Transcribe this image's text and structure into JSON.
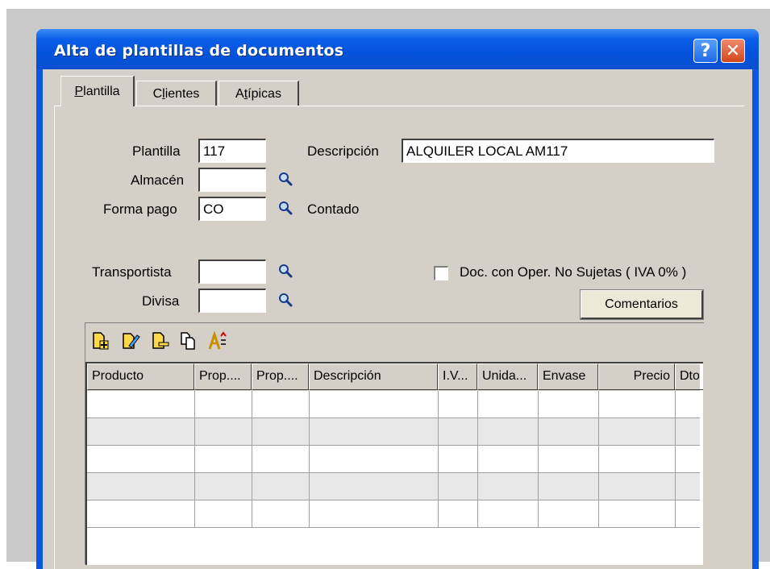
{
  "window": {
    "title": "Alta  de plantillas de documentos",
    "help_label": "?",
    "close_label": "✕"
  },
  "tabs": [
    {
      "label_ul": "P",
      "label_rest": "lantilla"
    },
    {
      "label_pre": "C",
      "label_ul": "l",
      "label_rest": "ientes"
    },
    {
      "label_pre": "A",
      "label_ul": "t",
      "label_rest": "ípicas"
    }
  ],
  "form": {
    "plantilla_label": "Plantilla",
    "plantilla_value": "117",
    "descripcion_label": "Descripción",
    "descripcion_value": "ALQUILER LOCAL AM117",
    "almacen_label": "Almacén",
    "almacen_value": "",
    "forma_pago_label": "Forma pago",
    "forma_pago_value": "CO",
    "forma_pago_desc": "Contado",
    "transportista_label": "Transportista",
    "transportista_value": "",
    "divisa_label": "Divisa",
    "divisa_value": "",
    "no_sujetas_label": "Doc. con Oper. No Sujetas ( IVA 0% )",
    "no_sujetas_checked": false,
    "comentarios_label": "Comentarios"
  },
  "toolbar_icons": [
    "add-line-icon",
    "edit-line-icon",
    "delete-line-icon",
    "copy-line-icon",
    "sort-text-icon"
  ],
  "grid": {
    "columns": [
      "Producto",
      "Prop....",
      "Prop....",
      "Descripción",
      "I.V...",
      "Unida...",
      "Envase",
      "Precio",
      "Dto"
    ],
    "row_count": 5
  }
}
